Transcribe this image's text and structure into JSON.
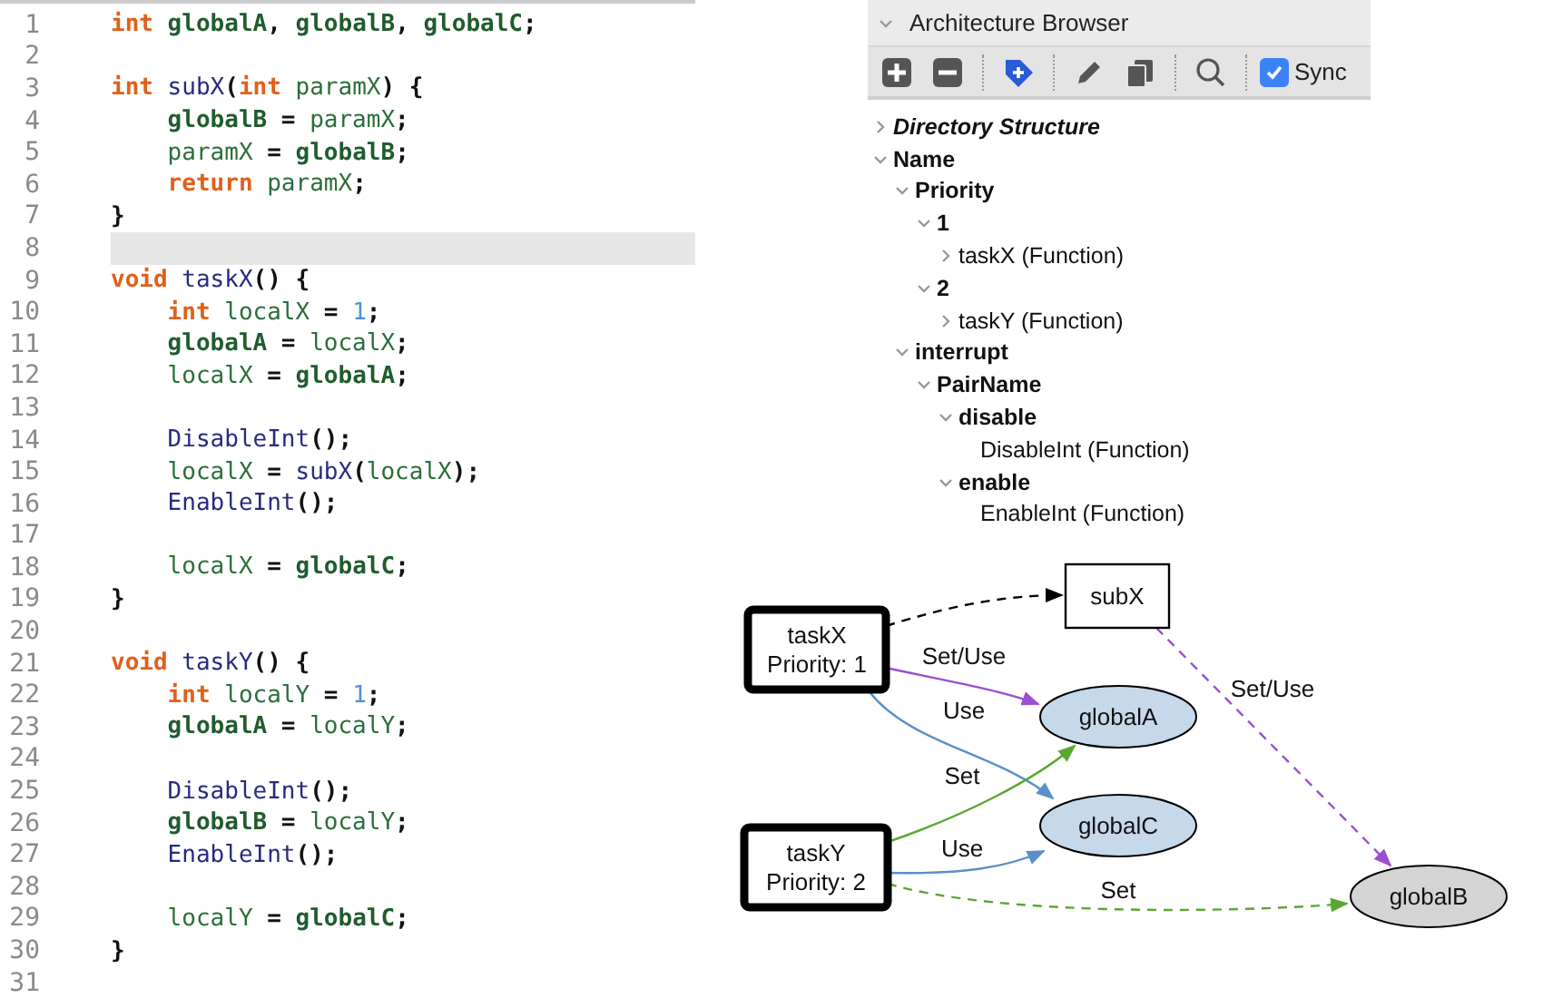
{
  "editor": {
    "lines": [
      {
        "number": "1",
        "highlighted": false,
        "tokens": [
          {
            "kind": "keyword",
            "text": "int"
          },
          {
            "kind": "global",
            "text": " globalA"
          },
          {
            "kind": "punct",
            "text": ", "
          },
          {
            "kind": "global",
            "text": "globalB"
          },
          {
            "kind": "punct",
            "text": ", "
          },
          {
            "kind": "global",
            "text": "globalC"
          },
          {
            "kind": "punct",
            "text": ";"
          }
        ]
      },
      {
        "number": "2",
        "highlighted": false
      },
      {
        "number": "3",
        "highlighted": false,
        "tokens": [
          {
            "kind": "keyword",
            "text": "int"
          },
          {
            "kind": "func",
            "text": " subX"
          },
          {
            "kind": "punct",
            "text": "("
          },
          {
            "kind": "keyword",
            "text": "int"
          },
          {
            "kind": "local",
            "text": " paramX"
          },
          {
            "kind": "punct",
            "text": ") {"
          }
        ]
      },
      {
        "number": "4",
        "highlighted": false,
        "tokens": [
          {
            "kind": "global",
            "text": "    globalB"
          },
          {
            "kind": "punct",
            "text": " = "
          },
          {
            "kind": "local",
            "text": "paramX"
          },
          {
            "kind": "punct",
            "text": ";"
          }
        ]
      },
      {
        "number": "5",
        "highlighted": false,
        "tokens": [
          {
            "kind": "local",
            "text": "    paramX"
          },
          {
            "kind": "punct",
            "text": " = "
          },
          {
            "kind": "global",
            "text": "globalB"
          },
          {
            "kind": "punct",
            "text": ";"
          }
        ]
      },
      {
        "number": "6",
        "highlighted": false,
        "tokens": [
          {
            "kind": "keyword",
            "text": "    return"
          },
          {
            "kind": "local",
            "text": " paramX"
          },
          {
            "kind": "punct",
            "text": ";"
          }
        ]
      },
      {
        "number": "7",
        "highlighted": false,
        "tokens": [
          {
            "kind": "punct",
            "text": "}"
          }
        ]
      },
      {
        "number": "8",
        "highlighted": true
      },
      {
        "number": "9",
        "highlighted": false,
        "tokens": [
          {
            "kind": "keyword",
            "text": "void"
          },
          {
            "kind": "func",
            "text": " taskX"
          },
          {
            "kind": "punct",
            "text": "() {"
          }
        ]
      },
      {
        "number": "10",
        "highlighted": false,
        "tokens": [
          {
            "kind": "keyword",
            "text": "    int"
          },
          {
            "kind": "local",
            "text": " localX"
          },
          {
            "kind": "punct",
            "text": " = "
          },
          {
            "kind": "number",
            "text": "1"
          },
          {
            "kind": "punct",
            "text": ";"
          }
        ]
      },
      {
        "number": "11",
        "highlighted": false,
        "tokens": [
          {
            "kind": "global",
            "text": "    globalA"
          },
          {
            "kind": "punct",
            "text": " = "
          },
          {
            "kind": "local",
            "text": "localX"
          },
          {
            "kind": "punct",
            "text": ";"
          }
        ]
      },
      {
        "number": "12",
        "highlighted": false,
        "tokens": [
          {
            "kind": "local",
            "text": "    localX"
          },
          {
            "kind": "punct",
            "text": " = "
          },
          {
            "kind": "global",
            "text": "globalA"
          },
          {
            "kind": "punct",
            "text": ";"
          }
        ]
      },
      {
        "number": "13",
        "highlighted": false
      },
      {
        "number": "14",
        "highlighted": false,
        "tokens": [
          {
            "kind": "func",
            "text": "    DisableInt"
          },
          {
            "kind": "punct",
            "text": "();"
          }
        ]
      },
      {
        "number": "15",
        "highlighted": false,
        "tokens": [
          {
            "kind": "local",
            "text": "    localX"
          },
          {
            "kind": "punct",
            "text": " = "
          },
          {
            "kind": "func",
            "text": "subX"
          },
          {
            "kind": "punct",
            "text": "("
          },
          {
            "kind": "local",
            "text": "localX"
          },
          {
            "kind": "punct",
            "text": ");"
          }
        ]
      },
      {
        "number": "16",
        "highlighted": false,
        "tokens": [
          {
            "kind": "func",
            "text": "    EnableInt"
          },
          {
            "kind": "punct",
            "text": "();"
          }
        ]
      },
      {
        "number": "17",
        "highlighted": false
      },
      {
        "number": "18",
        "highlighted": false,
        "tokens": [
          {
            "kind": "local",
            "text": "    localX"
          },
          {
            "kind": "punct",
            "text": " = "
          },
          {
            "kind": "global",
            "text": "globalC"
          },
          {
            "kind": "punct",
            "text": ";"
          }
        ]
      },
      {
        "number": "19",
        "highlighted": false,
        "tokens": [
          {
            "kind": "punct",
            "text": "}"
          }
        ]
      },
      {
        "number": "20",
        "highlighted": false
      },
      {
        "number": "21",
        "highlighted": false,
        "tokens": [
          {
            "kind": "keyword",
            "text": "void"
          },
          {
            "kind": "func",
            "text": " taskY"
          },
          {
            "kind": "punct",
            "text": "() {"
          }
        ]
      },
      {
        "number": "22",
        "highlighted": false,
        "tokens": [
          {
            "kind": "keyword",
            "text": "    int"
          },
          {
            "kind": "local",
            "text": " localY"
          },
          {
            "kind": "punct",
            "text": " = "
          },
          {
            "kind": "number",
            "text": "1"
          },
          {
            "kind": "punct",
            "text": ";"
          }
        ]
      },
      {
        "number": "23",
        "highlighted": false,
        "tokens": [
          {
            "kind": "global",
            "text": "    globalA"
          },
          {
            "kind": "punct",
            "text": " = "
          },
          {
            "kind": "local",
            "text": "localY"
          },
          {
            "kind": "punct",
            "text": ";"
          }
        ]
      },
      {
        "number": "24",
        "highlighted": false
      },
      {
        "number": "25",
        "highlighted": false,
        "tokens": [
          {
            "kind": "func",
            "text": "    DisableInt"
          },
          {
            "kind": "punct",
            "text": "();"
          }
        ]
      },
      {
        "number": "26",
        "highlighted": false,
        "tokens": [
          {
            "kind": "global",
            "text": "    globalB"
          },
          {
            "kind": "punct",
            "text": " = "
          },
          {
            "kind": "local",
            "text": "localY"
          },
          {
            "kind": "punct",
            "text": ";"
          }
        ]
      },
      {
        "number": "27",
        "highlighted": false,
        "tokens": [
          {
            "kind": "func",
            "text": "    EnableInt"
          },
          {
            "kind": "punct",
            "text": "();"
          }
        ]
      },
      {
        "number": "28",
        "highlighted": false
      },
      {
        "number": "29",
        "highlighted": false,
        "tokens": [
          {
            "kind": "local",
            "text": "    localY"
          },
          {
            "kind": "punct",
            "text": " = "
          },
          {
            "kind": "global",
            "text": "globalC"
          },
          {
            "kind": "punct",
            "text": ";"
          }
        ]
      },
      {
        "number": "30",
        "highlighted": false,
        "tokens": [
          {
            "kind": "punct",
            "text": "}"
          }
        ]
      },
      {
        "number": "31",
        "highlighted": false
      }
    ]
  },
  "browser": {
    "title": "Architecture Browser",
    "expanded": true,
    "toolbar": {
      "buttons": [
        {
          "kind": "add"
        },
        {
          "kind": "remove"
        },
        {
          "kind": "tag"
        },
        {
          "kind": "edit"
        },
        {
          "kind": "copy"
        },
        {
          "kind": "search"
        }
      ],
      "sync": {
        "label": "Sync",
        "checked": true
      }
    },
    "tree": [
      {
        "label": "Directory Structure",
        "kind": "group",
        "expanded": false
      },
      {
        "label": "Name",
        "kind": "category",
        "expanded": true,
        "children": [
          {
            "label": "Priority",
            "kind": "category",
            "expanded": true,
            "children": [
              {
                "label": "1",
                "kind": "category",
                "expanded": true,
                "children": [
                  {
                    "label": "taskX (Function)",
                    "kind": "function",
                    "expanded": false
                  }
                ]
              },
              {
                "label": "2",
                "kind": "category",
                "expanded": true,
                "children": [
                  {
                    "label": "taskY (Function)",
                    "kind": "function",
                    "expanded": false
                  }
                ]
              }
            ]
          },
          {
            "label": "interrupt",
            "kind": "category",
            "expanded": true,
            "children": [
              {
                "label": "PairName",
                "kind": "category",
                "expanded": true,
                "children": [
                  {
                    "label": "disable",
                    "kind": "category",
                    "expanded": true,
                    "children": [
                      {
                        "label": "DisableInt (Function)",
                        "kind": "function"
                      }
                    ]
                  },
                  {
                    "label": "enable",
                    "kind": "category",
                    "expanded": true,
                    "children": [
                      {
                        "label": "EnableInt (Function)",
                        "kind": "function"
                      }
                    ]
                  }
                ]
              }
            ]
          }
        ]
      }
    ]
  },
  "graph": {
    "nodes": [
      {
        "kind": "function",
        "lines": [
          "subX"
        ]
      },
      {
        "kind": "task",
        "lines": [
          "taskX",
          "Priority: 1"
        ]
      },
      {
        "kind": "task",
        "lines": [
          "taskY",
          "Priority: 2"
        ]
      },
      {
        "kind": "local_variable",
        "lines": [
          "globalA"
        ]
      },
      {
        "kind": "local_variable",
        "lines": [
          "globalC"
        ]
      },
      {
        "kind": "shared_variable",
        "lines": [
          "globalB"
        ]
      }
    ],
    "edges": [
      {
        "color": "#000000",
        "dashed": true
      },
      {
        "label": "Set/Use",
        "color": "#9b4fd0",
        "dashed": false
      },
      {
        "label": "Use",
        "color": "#5b8fc9",
        "dashed": false
      },
      {
        "label": "Set",
        "color": "#5aa832",
        "dashed": false
      },
      {
        "label": "Use",
        "color": "#5b8fc9",
        "dashed": false
      },
      {
        "label": "Set",
        "color": "#5aa832",
        "dashed": true
      },
      {
        "label": "Set/Use",
        "color": "#9b4fd0",
        "dashed": true
      }
    ]
  }
}
